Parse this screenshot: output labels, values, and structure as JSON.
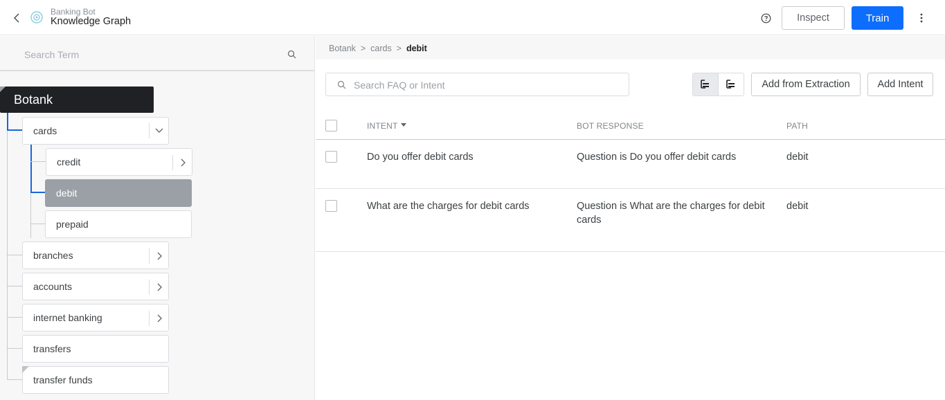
{
  "header": {
    "bot_name": "Banking Bot",
    "page_title": "Knowledge Graph",
    "inspect_label": "Inspect",
    "train_label": "Train",
    "accent": "#0d6efd"
  },
  "left": {
    "search_placeholder": "Search Term",
    "root_label": "Botank",
    "nodes": [
      {
        "label": "cards",
        "expanded": true
      },
      {
        "label": "credit"
      },
      {
        "label": "debit",
        "selected": true
      },
      {
        "label": "prepaid"
      },
      {
        "label": "branches"
      },
      {
        "label": "accounts"
      },
      {
        "label": "internet banking"
      },
      {
        "label": "transfers"
      },
      {
        "label": "transfer funds"
      }
    ]
  },
  "breadcrumb": {
    "items": [
      "Botank",
      ">",
      "cards",
      ">",
      "debit"
    ]
  },
  "toolbar": {
    "search_placeholder": "Search FAQ or Intent",
    "add_from_extraction_label": "Add from Extraction",
    "add_intent_label": "Add Intent"
  },
  "table": {
    "columns": [
      "INTENT",
      "BOT RESPONSE",
      "PATH"
    ],
    "rows": [
      {
        "intent": "Do you offer debit cards",
        "response": "Question is Do you offer debit cards",
        "path": "debit"
      },
      {
        "intent": "What are the charges for debit cards",
        "response_line1": "Question is What are the charges for debit",
        "response_line2": "cards",
        "path": "debit"
      }
    ]
  }
}
